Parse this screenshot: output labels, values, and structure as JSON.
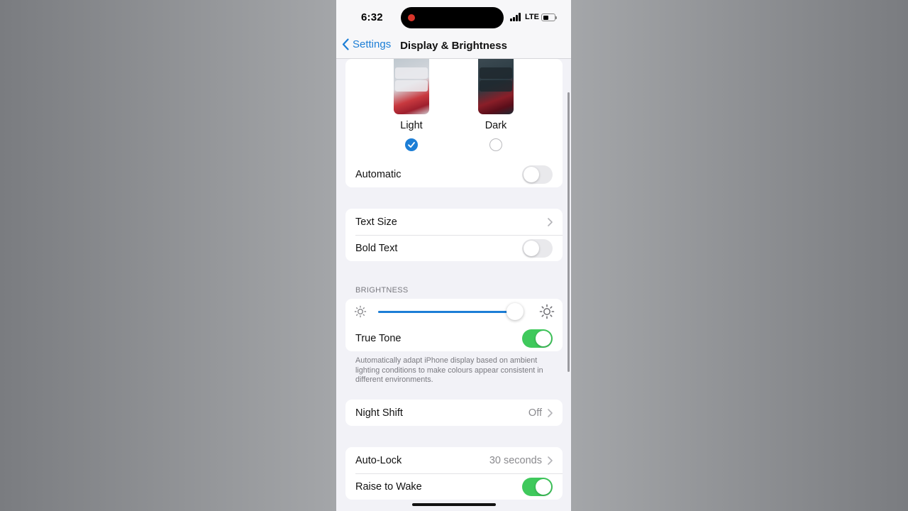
{
  "status": {
    "time": "6:32",
    "network": "LTE",
    "battery_level": 0.45
  },
  "nav": {
    "back_label": "Settings",
    "title": "Display & Brightness"
  },
  "appearance": {
    "light_label": "Light",
    "dark_label": "Dark",
    "selected": "Light",
    "automatic_label": "Automatic",
    "automatic_on": false
  },
  "text_section": {
    "text_size_label": "Text Size",
    "bold_text_label": "Bold Text",
    "bold_text_on": false
  },
  "brightness": {
    "header": "BRIGHTNESS",
    "level": 0.94,
    "true_tone_label": "True Tone",
    "true_tone_on": true,
    "footnote": "Automatically adapt iPhone display based on ambient lighting conditions to make colours appear consistent in different environments."
  },
  "night_shift": {
    "label": "Night Shift",
    "value": "Off"
  },
  "lock": {
    "auto_lock_label": "Auto-Lock",
    "auto_lock_value": "30 seconds",
    "raise_to_wake_label": "Raise to Wake",
    "raise_to_wake_on": true
  },
  "colors": {
    "accent": "#1c7ed6",
    "toggle_on": "#3fc95c",
    "background": "#f2f2f7"
  }
}
